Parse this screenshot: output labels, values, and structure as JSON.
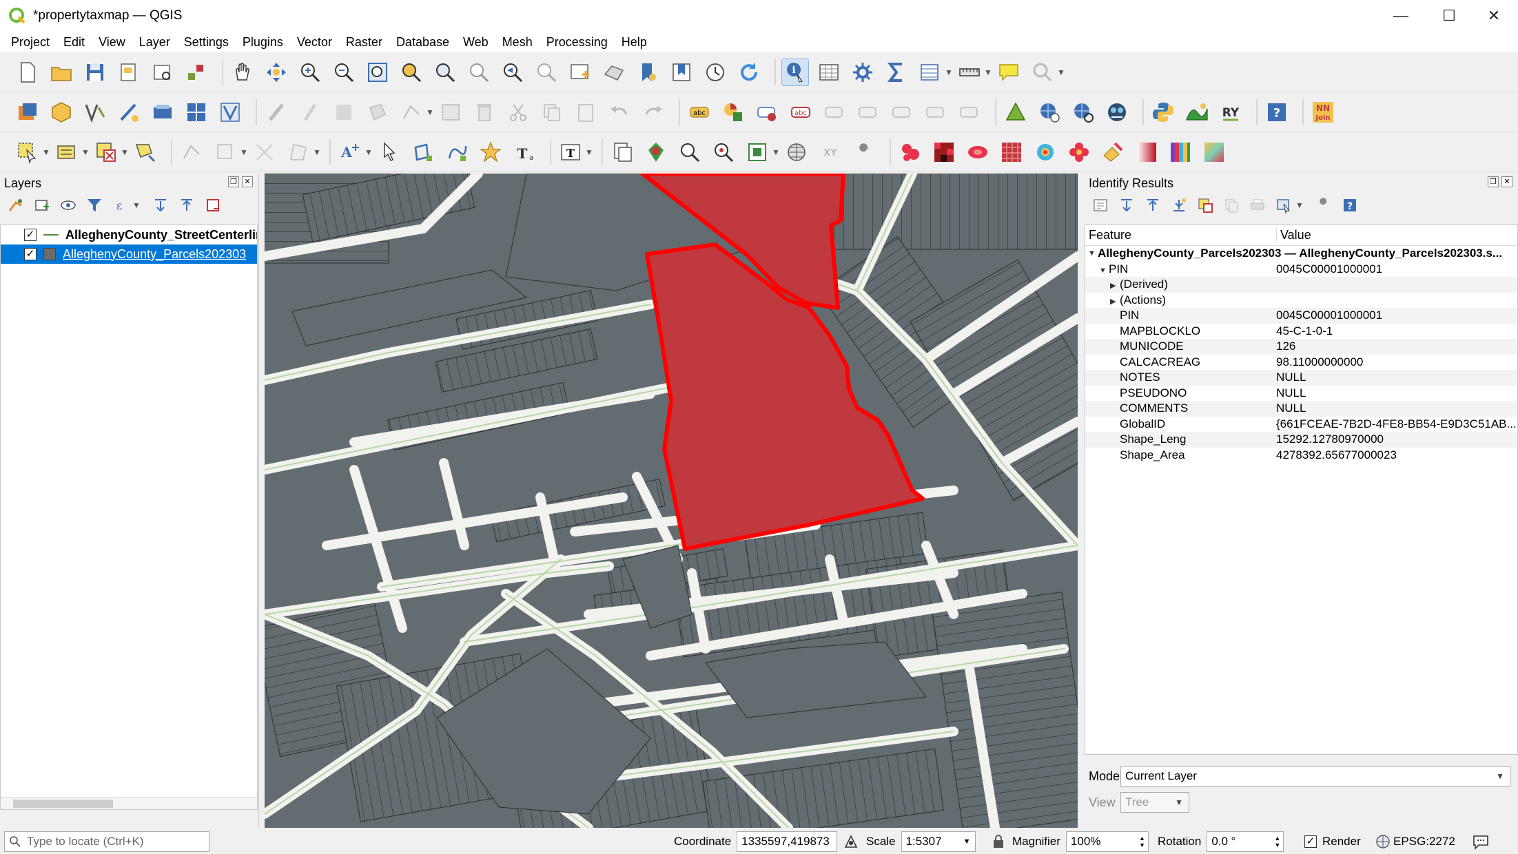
{
  "window": {
    "title": "*propertytaxmap — QGIS",
    "minimize": "—",
    "maximize": "☐",
    "close": "✕"
  },
  "menu": [
    "Project",
    "Edit",
    "View",
    "Layer",
    "Settings",
    "Plugins",
    "Vector",
    "Raster",
    "Database",
    "Web",
    "Mesh",
    "Processing",
    "Help"
  ],
  "layers_panel": {
    "title": "Layers",
    "layers": [
      {
        "name": "AlleghenyCounty_StreetCenterlin",
        "checked": "✓"
      },
      {
        "name": "AlleghenyCounty_Parcels202303",
        "checked": "✓"
      }
    ]
  },
  "identify": {
    "title": "Identify Results",
    "col_feature": "Feature",
    "col_value": "Value",
    "feature_label": "AlleghenyCounty_Parcels202303 — AlleghenyCounty_Parcels202303.s...",
    "pin_label": "PIN",
    "pin_value": "0045C00001000001",
    "derived": "(Derived)",
    "actions": "(Actions)",
    "attributes": [
      {
        "key": "PIN",
        "value": "0045C00001000001"
      },
      {
        "key": "MAPBLOCKLO",
        "value": "45-C-1-0-1"
      },
      {
        "key": "MUNICODE",
        "value": "126"
      },
      {
        "key": "CALCACREAG",
        "value": "98.11000000000"
      },
      {
        "key": "NOTES",
        "value": "NULL"
      },
      {
        "key": "PSEUDONO",
        "value": "NULL"
      },
      {
        "key": "COMMENTS",
        "value": "NULL"
      },
      {
        "key": "GlobalID",
        "value": "{661FCEAE-7B2D-4FE8-BB54-E9D3C51AB..."
      },
      {
        "key": "Shape_Leng",
        "value": "15292.12780970000"
      },
      {
        "key": "Shape_Area",
        "value": "4278392.65677000023"
      }
    ],
    "mode_label": "Mode",
    "mode_value": "Current Layer",
    "view_label": "View",
    "view_value": "Tree"
  },
  "statusbar": {
    "locate_placeholder": "Type to locate (Ctrl+K)",
    "coordinate_label": "Coordinate",
    "coordinate_value": "1335597,419873",
    "scale_label": "Scale",
    "scale_value": "1:5307",
    "magnifier_label": "Magnifier",
    "magnifier_value": "100%",
    "rotation_label": "Rotation",
    "rotation_value": "0.0 °",
    "render_label": "Render",
    "render_checked": "✓",
    "crs_value": "EPSG:2272"
  },
  "colors": {
    "selection_fill": "#c0393f",
    "selection_stroke": "#ff0000",
    "parcel_fill": "#636c70",
    "street_line": "#c5dfb8",
    "accent": "#0078d7"
  }
}
